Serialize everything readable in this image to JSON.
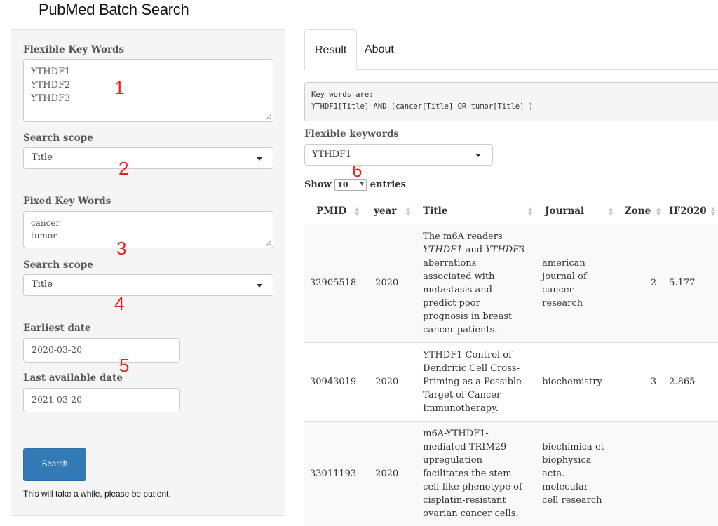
{
  "app": {
    "title": "PubMed Batch Search"
  },
  "sidebar": {
    "flexible_label": "Flexible Key Words",
    "flexible_lines": [
      "YTHDF1",
      "YTHDF2",
      "YTHDF3"
    ],
    "scope1_label": "Search scope",
    "scope1_value": "Title",
    "fixed_label": "Fixed Key Words",
    "fixed_lines": [
      "cancer",
      "tumor"
    ],
    "scope2_label": "Search scope",
    "scope2_value": "Title",
    "earliest_label": "Earliest date",
    "earliest_value": "2020-03-20",
    "last_label": "Last available date",
    "last_value": "2021-03-20",
    "search_button": "Search",
    "note": "This will take a while, please be patient."
  },
  "annotations": [
    "1",
    "2",
    "3",
    "4",
    "5",
    "6"
  ],
  "tabs": {
    "result": "Result",
    "about": "About"
  },
  "result": {
    "query_line1": "Key words are:",
    "query_line2": "YTHDF1[Title] AND (cancer[Title] OR tumor[Title] )",
    "flex_label": "Flexible keywords",
    "flex_value": "YTHDF1",
    "show_label": "Show",
    "page_length": "10",
    "entries_label": "entries"
  },
  "table": {
    "headers": [
      "PMID",
      "year",
      "Title",
      "Journal",
      "Zone",
      "IF2020"
    ],
    "rows": [
      {
        "pmid": "32905518",
        "year": "2020",
        "title_parts": [
          {
            "text": "The m6A readers ",
            "italic": false
          },
          {
            "text": "YTHDF1",
            "italic": true
          },
          {
            "text": " and ",
            "italic": false
          },
          {
            "text": "YTHDF3",
            "italic": true
          },
          {
            "text": " aberrations associated with metastasis and predict poor prognosis in breast cancer patients.",
            "italic": false
          }
        ],
        "journal": "american journal of cancer research",
        "zone": "2",
        "if2020": "5.177"
      },
      {
        "pmid": "30943019",
        "year": "2020",
        "title_parts": [
          {
            "text": "YTHDF1 Control of Dendritic Cell Cross-Priming as a Possible Target of Cancer Immunotherapy.",
            "italic": false
          }
        ],
        "journal": "biochemistry",
        "zone": "3",
        "if2020": "2.865"
      },
      {
        "pmid": "33011193",
        "year": "2020",
        "title_parts": [
          {
            "text": "m6A-YTHDF1-mediated TRIM29 upregulation facilitates the stem cell-like phenotype of cisplatin-resistant ovarian cancer cells.",
            "italic": false
          }
        ],
        "journal": "biochimica et biophysica acta. molecular cell research",
        "zone": "",
        "if2020": ""
      }
    ]
  }
}
